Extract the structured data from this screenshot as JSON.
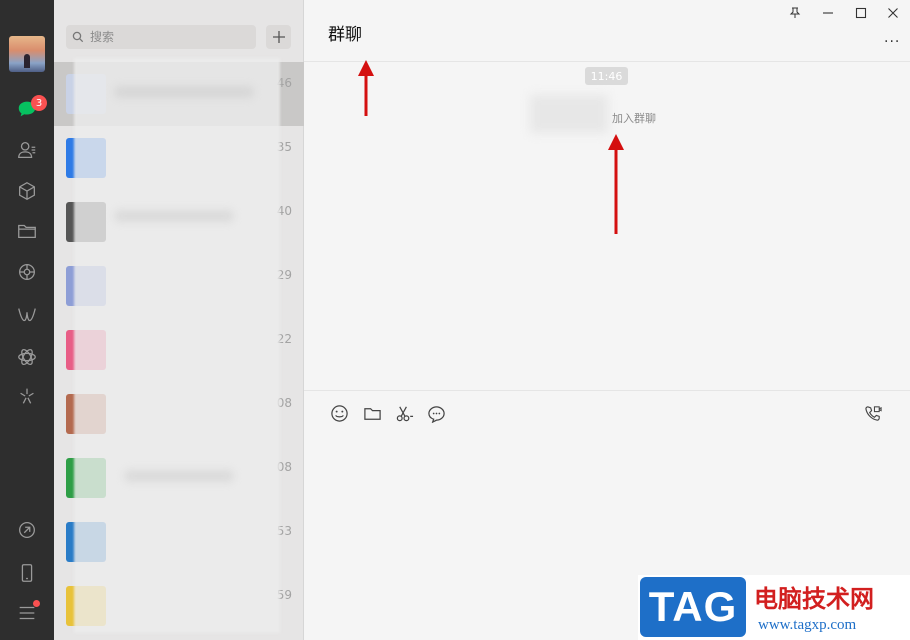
{
  "rail": {
    "chat_badge": "3",
    "icons": [
      "chat-icon",
      "contacts-icon",
      "box-icon",
      "folder-icon",
      "moments-icon",
      "channels-icon",
      "miniprogram-icon",
      "search-spark-icon",
      "link-icon",
      "phone-icon",
      "menu-icon"
    ]
  },
  "search": {
    "placeholder": "搜索"
  },
  "list": {
    "times": [
      "46",
      "35",
      "40",
      "29",
      "22",
      "08",
      "08",
      "53",
      "59"
    ],
    "thumb_colors": [
      "#c9d2e6",
      "#2f7be6",
      "#555555",
      "#8e9ed6",
      "#e85d86",
      "#b46a4f",
      "#2e9e46",
      "#2a7cc7",
      "#e8c23a"
    ]
  },
  "chat": {
    "title": "群聊",
    "time": "11:46",
    "system_message": "加入群聊",
    "more_label": "···"
  },
  "watermark": {
    "tag": "TAG",
    "site_cn": "电脑技术网",
    "url": "www.tagxp.com"
  },
  "colors": {
    "accent": "#07c160",
    "badge": "#fa5151",
    "arrow": "#d40f0f"
  }
}
